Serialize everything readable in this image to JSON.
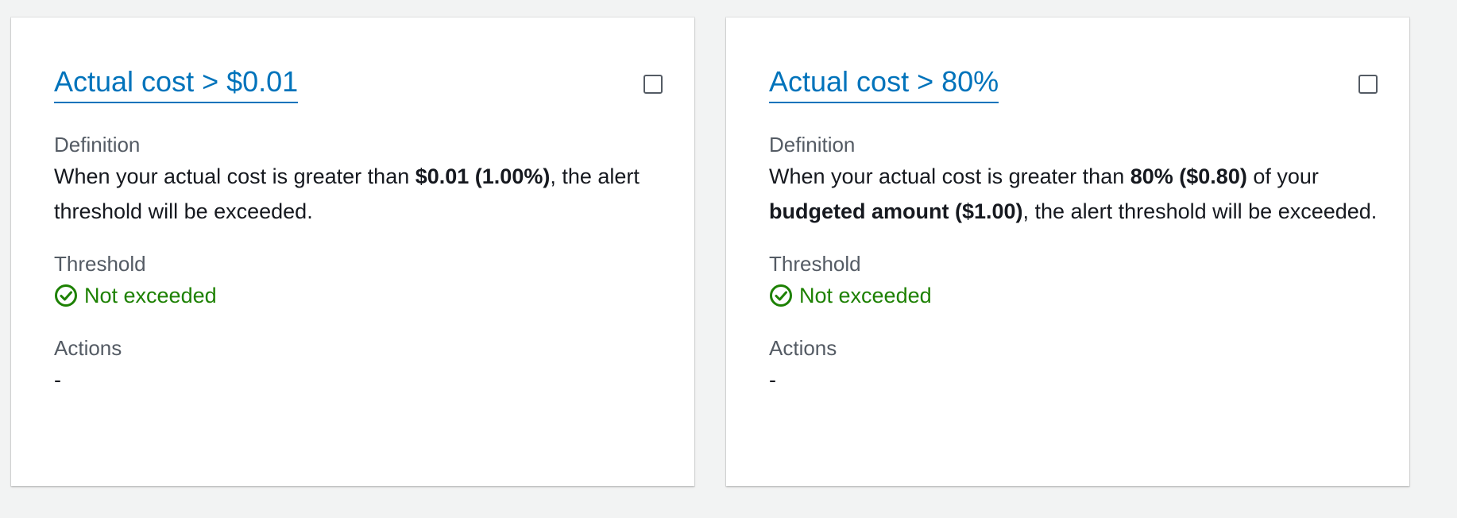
{
  "cards": [
    {
      "title": "Actual cost > $0.01",
      "definition_label": "Definition",
      "definition_parts": {
        "p1": "When your actual cost is greater than ",
        "b1": "$0.01 (1.00%)",
        "p2": ", the alert threshold will be exceeded."
      },
      "threshold_label": "Threshold",
      "threshold_status": "Not exceeded",
      "actions_label": "Actions",
      "actions_value": "-"
    },
    {
      "title": "Actual cost > 80%",
      "definition_label": "Definition",
      "definition_parts": {
        "p1": "When your actual cost is greater than ",
        "b1": "80% ($0.80)",
        "p2": " of your ",
        "b2": "budgeted amount ($1.00)",
        "p3": ", the alert threshold will be exceeded."
      },
      "threshold_label": "Threshold",
      "threshold_status": "Not exceeded",
      "actions_label": "Actions",
      "actions_value": "-"
    }
  ],
  "colors": {
    "link": "#0073bb",
    "success": "#1d8102",
    "label": "#545b64",
    "background": "#f2f3f3"
  },
  "icons": {
    "status": "check-circle-icon",
    "select": "checkbox"
  }
}
